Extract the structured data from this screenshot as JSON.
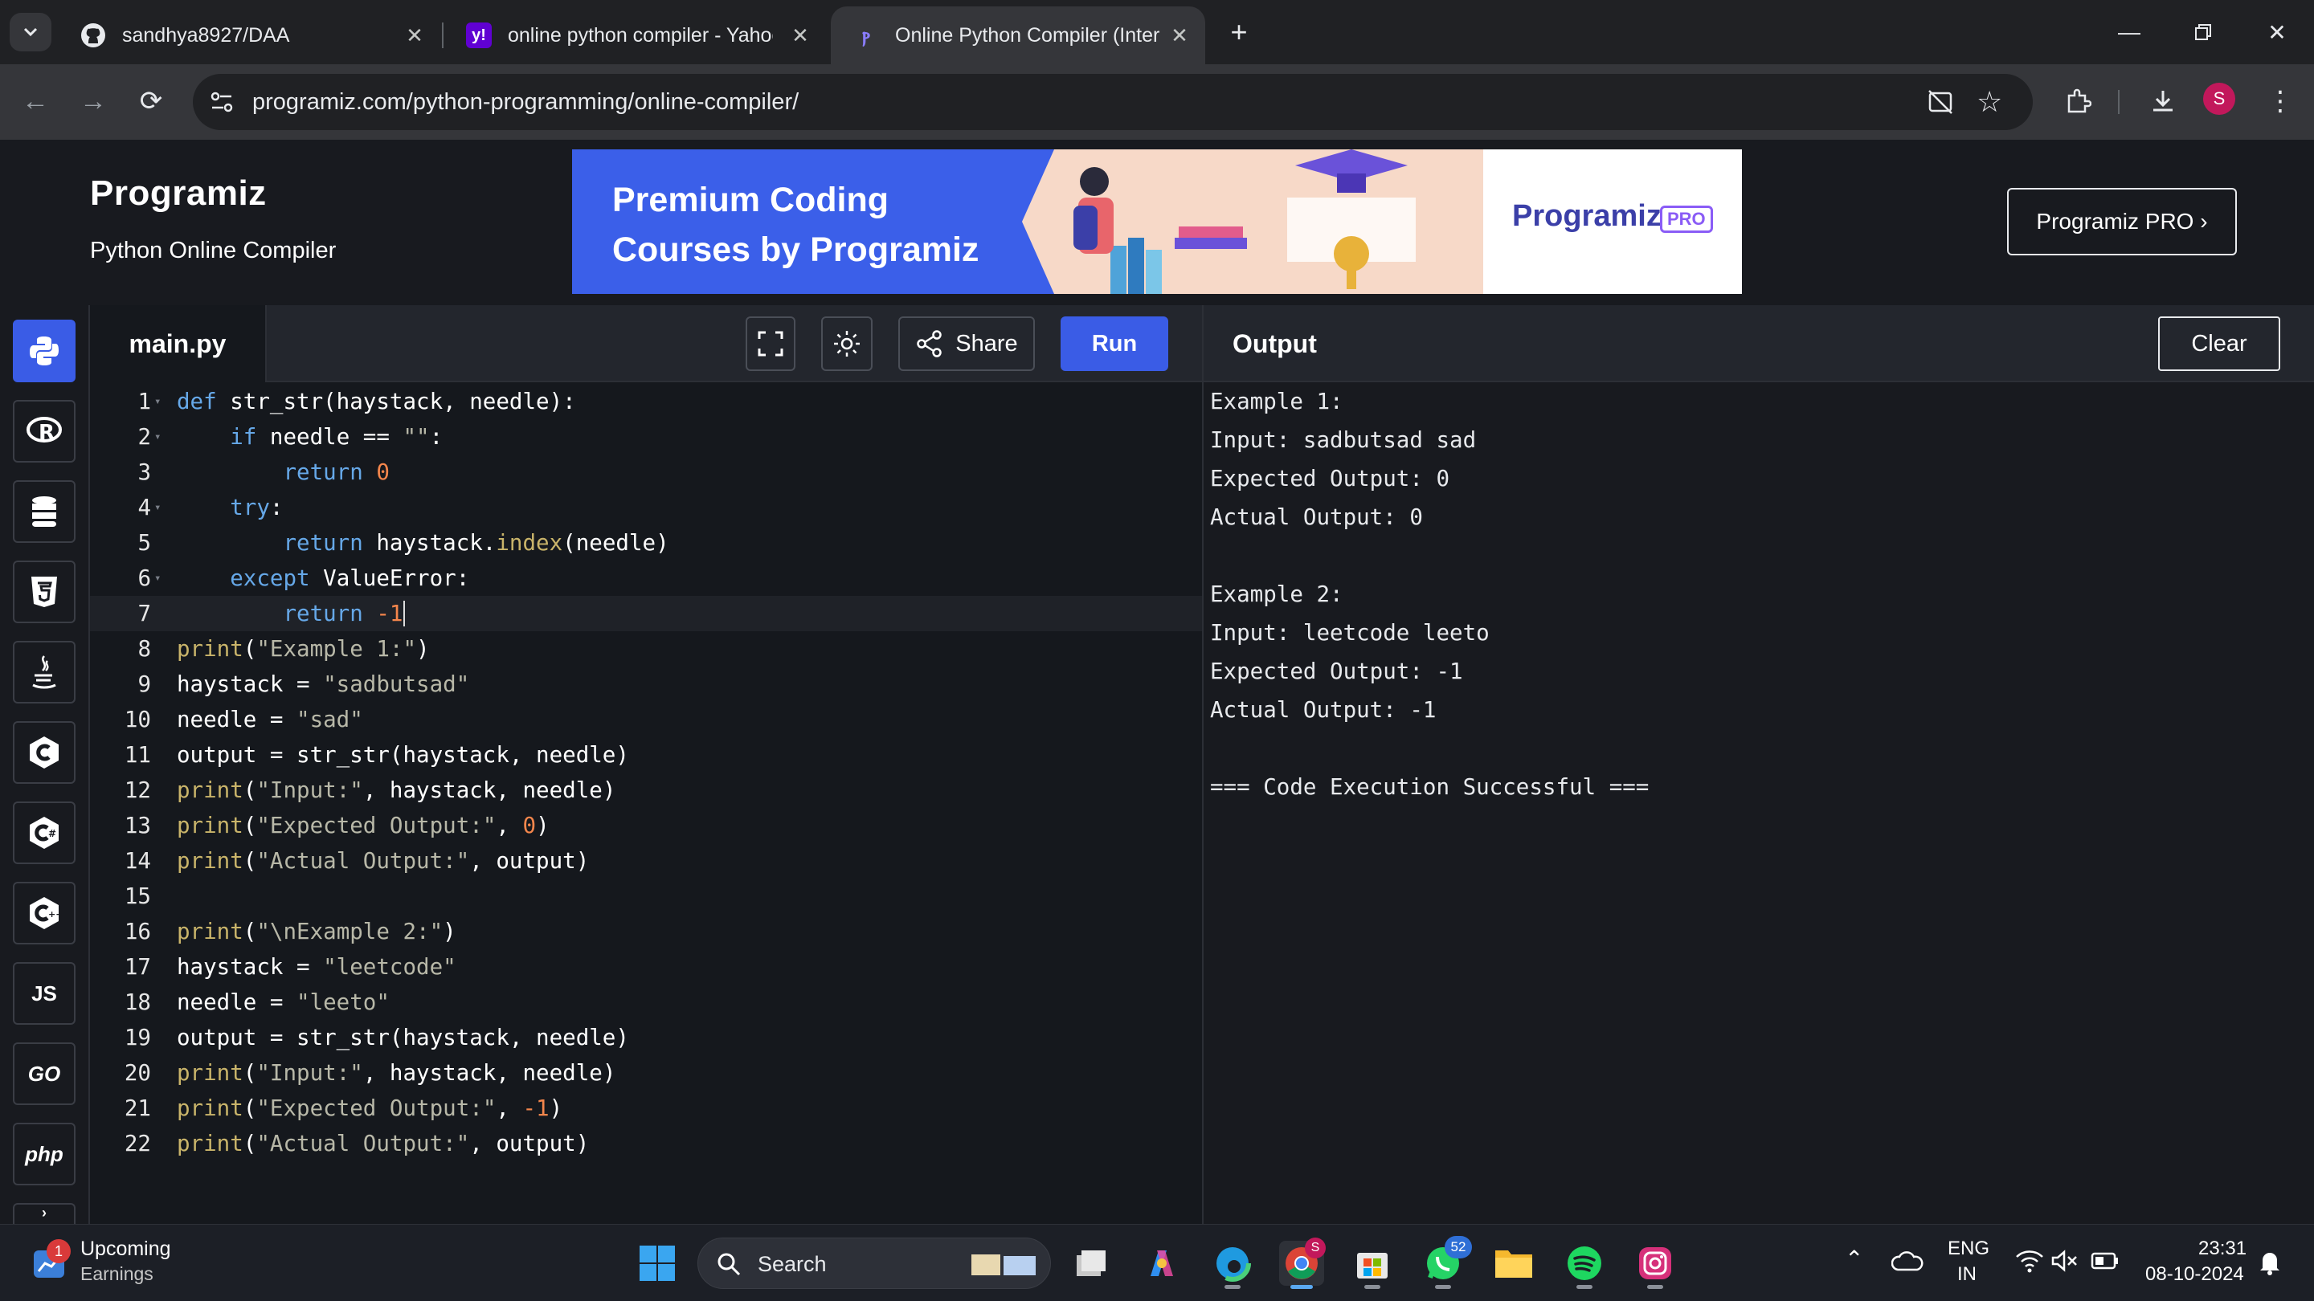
{
  "browser": {
    "tabs": [
      {
        "title": "sandhya8927/DAA",
        "favicon": "github-icon"
      },
      {
        "title": "online python compiler - Yahoo",
        "favicon": "yahoo-icon"
      },
      {
        "title": "Online Python Compiler (Interp",
        "favicon": "programiz-icon"
      }
    ],
    "active_tab": 2,
    "url": "programiz.com/python-programming/online-compiler/",
    "profile_initial": "S"
  },
  "site": {
    "logo": "Programiz",
    "subtitle": "Python Online Compiler",
    "banner": {
      "line1": "Premium Coding",
      "line2": "Courses by Programiz",
      "brand": "Programiz",
      "badge": "PRO"
    },
    "pro_button": "Programiz PRO ›"
  },
  "editor": {
    "file_tab": "main.py",
    "share_label": "Share",
    "run_label": "Run",
    "code_lines": [
      "def str_str(haystack, needle):",
      "    if needle == \"\":",
      "        return 0",
      "    try:",
      "        return haystack.index(needle)",
      "    except ValueError:",
      "        return -1",
      "print(\"Example 1:\")",
      "haystack = \"sadbutsad\"",
      "needle = \"sad\"",
      "output = str_str(haystack, needle)",
      "print(\"Input:\", haystack, needle)",
      "print(\"Expected Output:\", 0)",
      "print(\"Actual Output:\", output)",
      "",
      "print(\"\\nExample 2:\")",
      "haystack = \"leetcode\"",
      "needle = \"leeto\"",
      "output = str_str(haystack, needle)",
      "print(\"Input:\", haystack, needle)",
      "print(\"Expected Output:\", -1)",
      "print(\"Actual Output:\", output)"
    ],
    "fold_lines": [
      1,
      2,
      4,
      6
    ],
    "current_line": 7
  },
  "output": {
    "title": "Output",
    "clear_label": "Clear",
    "lines": [
      "Example 1:",
      "Input: sadbutsad sad",
      "Expected Output: 0",
      "Actual Output: 0",
      "",
      "Example 2:",
      "Input: leetcode leeto",
      "Expected Output: -1",
      "Actual Output: -1",
      "",
      "=== Code Execution Successful ==="
    ]
  },
  "languages": [
    "python-icon",
    "r-icon",
    "sql-icon",
    "html5-icon",
    "java-icon",
    "c-icon",
    "csharp-icon",
    "cpp-icon",
    "JS",
    "GO",
    "php"
  ],
  "taskbar": {
    "widget_title": "Upcoming",
    "widget_sub": "Earnings",
    "widget_badge": "1",
    "search_label": "Search",
    "chrome_badge": "S",
    "whatsapp_badge": "52",
    "lang_top": "ENG",
    "lang_bottom": "IN",
    "time": "23:31",
    "date": "08-10-2024"
  }
}
